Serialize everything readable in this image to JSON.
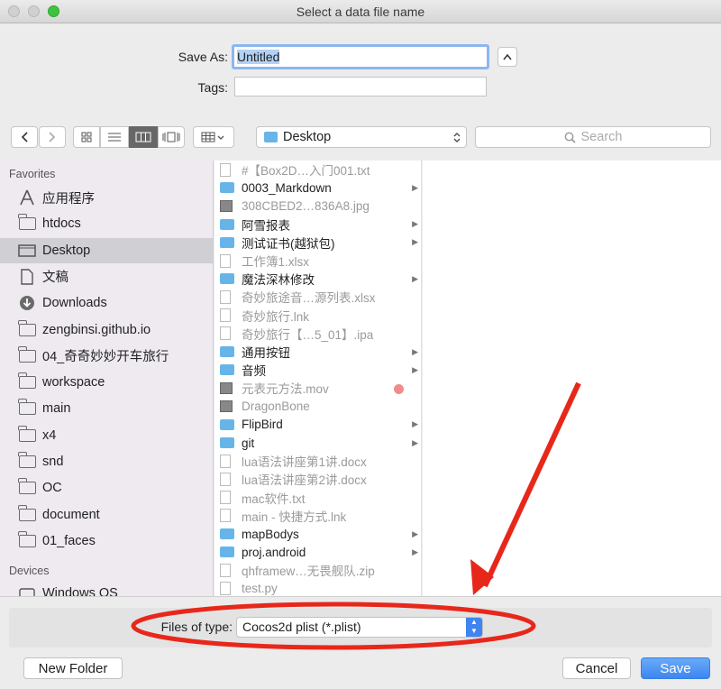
{
  "window": {
    "title": "Select a data file name"
  },
  "form": {
    "save_as_label": "Save As:",
    "save_as_value": "Untitled",
    "tags_label": "Tags:",
    "tags_value": ""
  },
  "toolbar": {
    "location": "Desktop",
    "search_placeholder": "Search"
  },
  "sidebar": {
    "favorites_header": "Favorites",
    "favorites": [
      {
        "label": "应用程序",
        "icon": "applications-icon"
      },
      {
        "label": "htdocs",
        "icon": "folder-icon"
      },
      {
        "label": "Desktop",
        "icon": "desktop-icon",
        "selected": true
      },
      {
        "label": "文稿",
        "icon": "documents-icon"
      },
      {
        "label": "Downloads",
        "icon": "downloads-icon"
      },
      {
        "label": "zengbinsi.github.io",
        "icon": "folder-icon"
      },
      {
        "label": "04_奇奇妙妙开车旅行",
        "icon": "folder-icon"
      },
      {
        "label": "workspace",
        "icon": "folder-icon"
      },
      {
        "label": "main",
        "icon": "folder-icon"
      },
      {
        "label": "x4",
        "icon": "folder-icon"
      },
      {
        "label": "snd",
        "icon": "folder-icon"
      },
      {
        "label": "OC",
        "icon": "folder-icon"
      },
      {
        "label": "document",
        "icon": "folder-icon"
      },
      {
        "label": "01_faces",
        "icon": "folder-icon"
      }
    ],
    "devices_header": "Devices",
    "devices": [
      {
        "label": "Windows OS",
        "icon": "disk-icon"
      }
    ]
  },
  "files": [
    {
      "name": "#【Box2D…入门001.txt",
      "type": "doc",
      "enabled": false
    },
    {
      "name": "0003_Markdown",
      "type": "folder",
      "enabled": true
    },
    {
      "name": "308CBED2…836A8.jpg",
      "type": "image",
      "enabled": false
    },
    {
      "name": "阿雪报表",
      "type": "folder",
      "enabled": true
    },
    {
      "name": "测试证书(越狱包)",
      "type": "folder",
      "enabled": true
    },
    {
      "name": "工作簿1.xlsx",
      "type": "doc",
      "enabled": false
    },
    {
      "name": "魔法深林修改",
      "type": "folder",
      "enabled": true
    },
    {
      "name": "奇妙旅途音…源列表.xlsx",
      "type": "doc",
      "enabled": false
    },
    {
      "name": "奇妙旅行.lnk",
      "type": "doc",
      "enabled": false
    },
    {
      "name": "奇妙旅行【…5_01】.ipa",
      "type": "doc",
      "enabled": false
    },
    {
      "name": "通用按钮",
      "type": "folder",
      "enabled": true
    },
    {
      "name": "音频",
      "type": "folder",
      "enabled": true
    },
    {
      "name": "元表元方法.mov",
      "type": "image",
      "enabled": false
    },
    {
      "name": "DragonBone",
      "type": "image",
      "enabled": false
    },
    {
      "name": "FlipBird",
      "type": "folder",
      "enabled": true
    },
    {
      "name": "git",
      "type": "folder",
      "enabled": true
    },
    {
      "name": "lua语法讲座第1讲.docx",
      "type": "doc",
      "enabled": false
    },
    {
      "name": "lua语法讲座第2讲.docx",
      "type": "doc",
      "enabled": false
    },
    {
      "name": "mac软件.txt",
      "type": "doc",
      "enabled": false
    },
    {
      "name": "main - 快捷方式.lnk",
      "type": "doc",
      "enabled": false
    },
    {
      "name": "mapBodys",
      "type": "folder",
      "enabled": true
    },
    {
      "name": "proj.android",
      "type": "folder",
      "enabled": true
    },
    {
      "name": "qhframew…无畏舰队.zip",
      "type": "doc",
      "enabled": false
    },
    {
      "name": "test.py",
      "type": "doc",
      "enabled": false
    }
  ],
  "filter": {
    "label": "Files of type:",
    "value": "Cocos2d plist (*.plist)"
  },
  "buttons": {
    "new_folder": "New Folder",
    "cancel": "Cancel",
    "save": "Save"
  },
  "colors": {
    "accent": "#3d86f2",
    "annotation_red": "#e8271b",
    "folder_blue": "#67b5e8"
  }
}
